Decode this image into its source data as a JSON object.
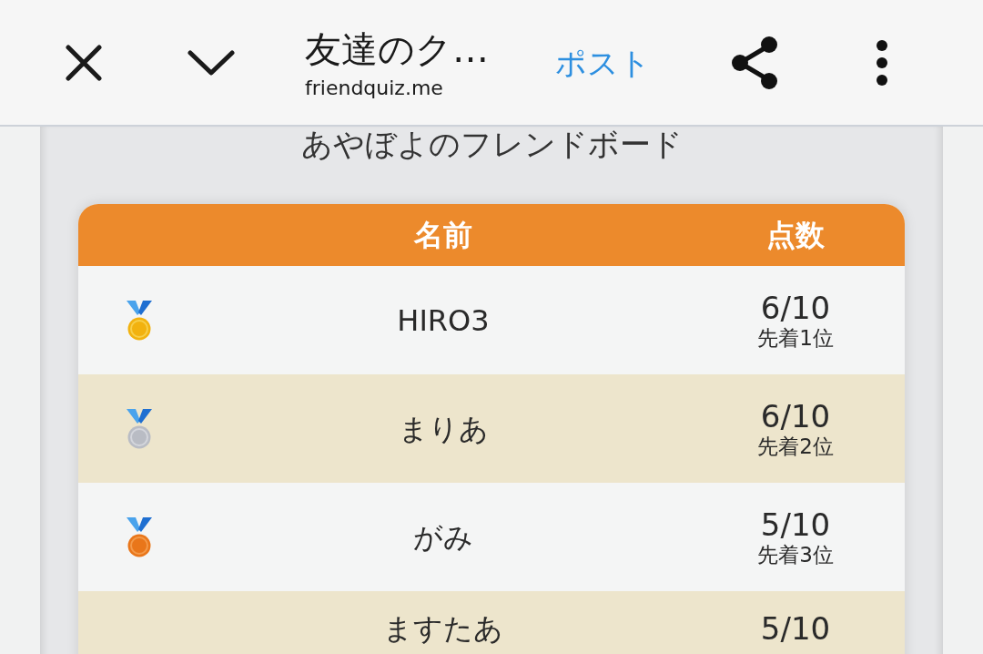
{
  "top_bar": {
    "title": "友達のク…",
    "url": "friendquiz.me",
    "post_button": "ポスト"
  },
  "board": {
    "title": "あやぼよのフレンドボード",
    "columns": [
      "名前",
      "点数"
    ],
    "rows": [
      {
        "kind": "gold",
        "name": "HIRO3",
        "score": "6/10",
        "rank": "先着1位"
      },
      {
        "kind": "silver",
        "name": "まりあ",
        "score": "6/10",
        "rank": "先着2位"
      },
      {
        "kind": "bronze",
        "name": "がみ",
        "score": "5/10",
        "rank": "先着3位"
      },
      {
        "kind": "plain",
        "name": "ますたあ",
        "score": "5/10"
      }
    ]
  }
}
